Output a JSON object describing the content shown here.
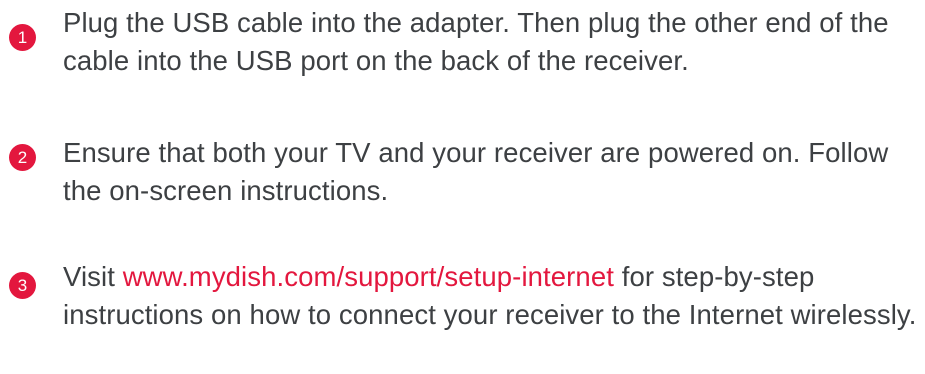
{
  "steps": [
    {
      "number": "1",
      "text": "Plug the USB cable into the adapter. Then plug the other end of the cable into the USB port on the back of the receiver."
    },
    {
      "number": "2",
      "text": "Ensure that both your TV and your receiver are powered on. Follow the on-screen instructions."
    },
    {
      "number": "3",
      "text_before": "Visit ",
      "link": "www.mydish.com/support/setup-internet",
      "text_after": " for step-by-step instructions on how to connect your receiver to the Internet wirelessly."
    }
  ],
  "colors": {
    "accent": "#e3173e",
    "text": "#3d4043",
    "background": "#ffffff"
  }
}
